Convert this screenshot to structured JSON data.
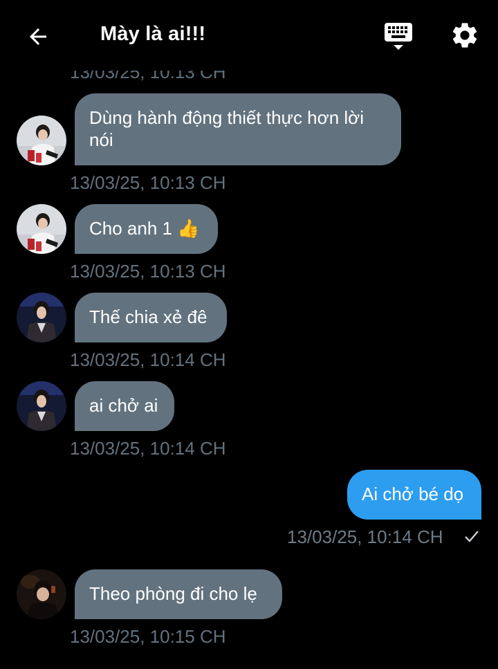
{
  "header": {
    "title": "Mày là ai!!!"
  },
  "clipped_timestamp": "13/03/25, 10:13 CH",
  "messages": [
    {
      "direction": "in",
      "avatar": "avatar-1",
      "text": "Dùng hành động thiết thực hơn lời nói",
      "time": "13/03/25, 10:13 CH"
    },
    {
      "direction": "in",
      "avatar": "avatar-1",
      "text": "Cho anh 1 👍",
      "time": "13/03/25, 10:13 CH"
    },
    {
      "direction": "in",
      "avatar": "avatar-2",
      "text": "Thế chia xẻ đê",
      "time": "13/03/25, 10:14 CH"
    },
    {
      "direction": "in",
      "avatar": "avatar-2",
      "text": "ai chở ai",
      "time": "13/03/25, 10:14 CH"
    },
    {
      "direction": "out",
      "text": "Ai chở bé dọ",
      "time": "13/03/25, 10:14 CH",
      "status": "✓"
    },
    {
      "direction": "in",
      "avatar": "avatar-3",
      "text": "Theo phòng đi cho lẹ",
      "time": "13/03/25, 10:15 CH"
    }
  ],
  "icons": {
    "back": "arrow-left-icon",
    "keyboard": "keyboard-icon",
    "settings": "gear-icon"
  },
  "colors": {
    "background": "#000000",
    "incoming_bubble": "#62727f",
    "outgoing_bubble": "#2d9df0",
    "timestamp": "#63727e"
  }
}
